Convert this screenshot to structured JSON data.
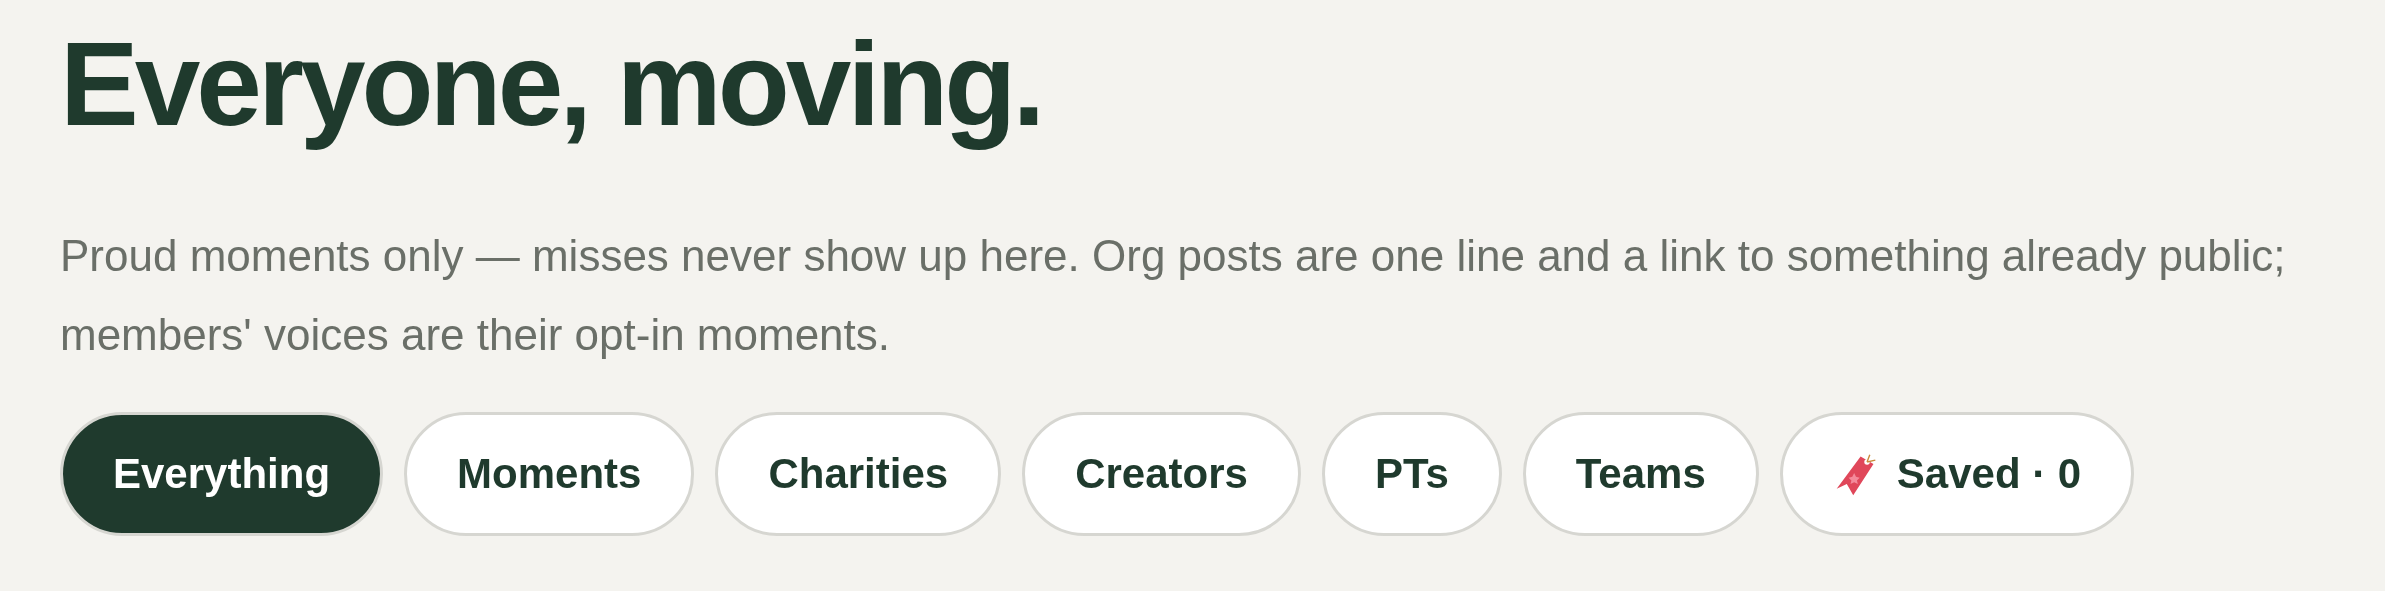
{
  "heading": "Everyone, moving.",
  "intro": "Proud moments only — misses never show up here. Org posts are one line and a link to something already public; members' voices are their opt-in moments.",
  "filters": [
    {
      "label": "Everything",
      "selected": true,
      "kind": "plain"
    },
    {
      "label": "Moments",
      "selected": false,
      "kind": "plain"
    },
    {
      "label": "Charities",
      "selected": false,
      "kind": "plain"
    },
    {
      "label": "Creators",
      "selected": false,
      "kind": "plain"
    },
    {
      "label": "PTs",
      "selected": false,
      "kind": "plain"
    },
    {
      "label": "Teams",
      "selected": false,
      "kind": "plain"
    },
    {
      "label": "Saved · 0",
      "selected": false,
      "kind": "saved"
    }
  ]
}
